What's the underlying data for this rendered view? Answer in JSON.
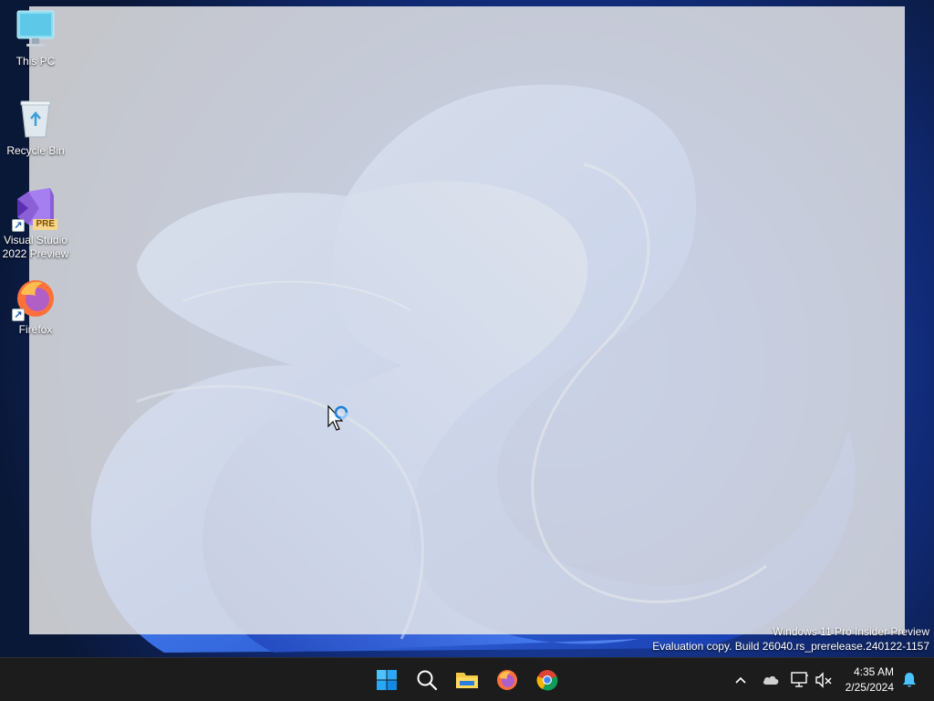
{
  "desktop": {
    "icons": [
      {
        "label": "This PC",
        "icon": "monitor-icon"
      },
      {
        "label": "Recycle Bin",
        "icon": "recycle-bin-icon"
      },
      {
        "label": "Visual Studio 2022 Preview",
        "icon": "visual-studio-icon",
        "badge": "PRE"
      },
      {
        "label": "Firefox",
        "icon": "firefox-icon"
      }
    ],
    "shortcut_arrow": "↗"
  },
  "watermark": {
    "line1": "Windows 11 Pro Insider Preview",
    "line2": "Evaluation copy. Build 26040.rs_prerelease.240122-1157"
  },
  "taskbar": {
    "apps": [
      "windows-start-icon",
      "search-icon",
      "file-explorer-icon",
      "firefox-icon",
      "chrome-icon"
    ],
    "tray": [
      "chevron-up-icon",
      "onedrive-cloud-icon",
      "network-icon",
      "volume-muted-icon",
      "notification-bell-icon"
    ],
    "clock": {
      "time": "4:35 AM",
      "date": "2/25/2024"
    }
  },
  "colors": {
    "taskbar_bg": "#1c1c1c",
    "accent": "#0078d4",
    "overlay": "#e8e8e8"
  }
}
